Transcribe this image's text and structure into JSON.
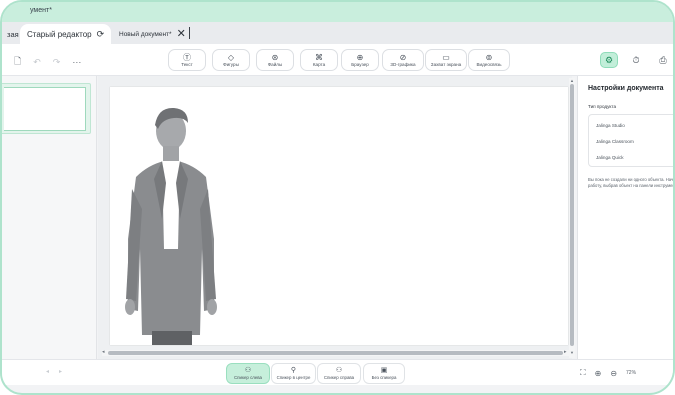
{
  "window": {
    "title": "умент*"
  },
  "tabs": [
    {
      "label": "зая",
      "active": false
    },
    {
      "label": "Старый редактор",
      "active": true
    },
    {
      "label": "Новый документ*",
      "active": false
    }
  ],
  "toolbar": {
    "left_icons": [
      "save-icon",
      "undo-icon",
      "redo-icon",
      "more-icon"
    ],
    "more_label": "···",
    "tools": [
      {
        "label": "Текст",
        "icon": "text-icon"
      },
      {
        "label": "Фигуры",
        "icon": "shapes-icon"
      },
      {
        "label": "Файлы",
        "icon": "files-icon"
      },
      {
        "label": "Карта",
        "icon": "map-icon"
      },
      {
        "label": "Браузер",
        "icon": "globe-icon"
      },
      {
        "label": "3D-графика",
        "icon": "cube-icon"
      },
      {
        "label": "Захват экрана",
        "icon": "screen-capture-icon"
      },
      {
        "label": "Видеосвязь",
        "icon": "video-call-icon"
      }
    ],
    "right_icons": [
      "document-settings-icon",
      "timer-icon",
      "print-icon",
      "export-icon"
    ]
  },
  "settings_panel": {
    "title": "Настройки документа",
    "product_type_label": "Тип продукта",
    "product_options": [
      "Jalinga Studio",
      "Jalinga Classroom",
      "Jalinga Quick"
    ],
    "note": "Вы пока не создали ни одного объекта. Начните работу, выбрав объект на панели инструментов"
  },
  "speaker_modes": [
    {
      "label": "Спикер слева",
      "active": true
    },
    {
      "label": "Спикер в центре",
      "active": false
    },
    {
      "label": "Спикер справа",
      "active": false
    },
    {
      "label": "Без спикера",
      "active": false
    }
  ],
  "zoom": {
    "value": "72%"
  },
  "colors": {
    "accent": "#1c8a5a",
    "accent_bg": "#c6efdb",
    "frame": "#aee3cc"
  }
}
